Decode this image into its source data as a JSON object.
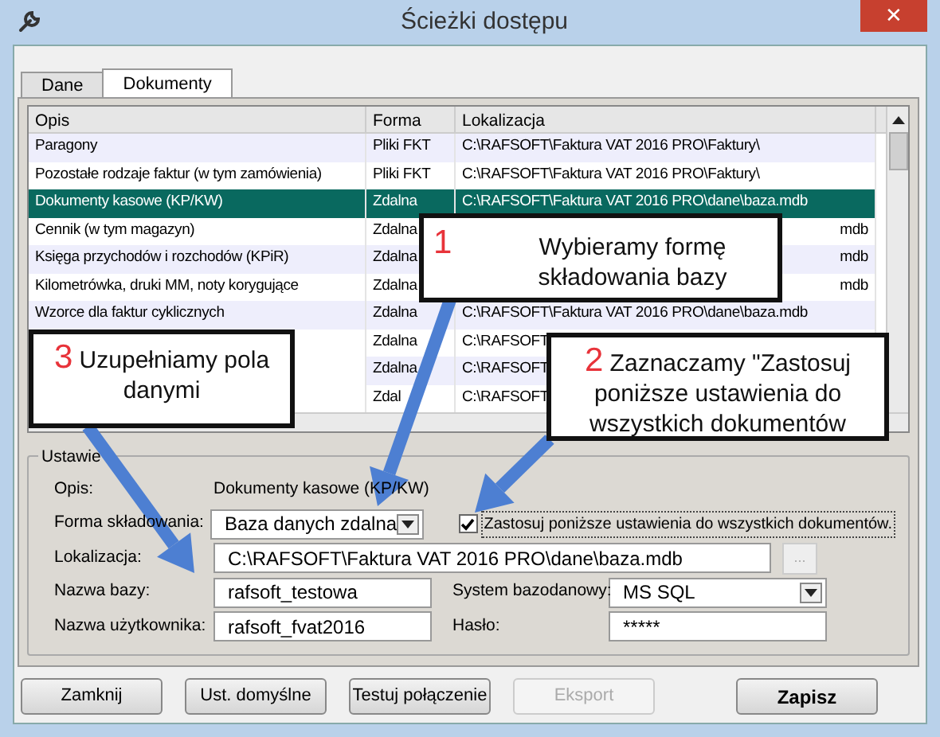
{
  "window": {
    "title": "Ścieżki dostępu",
    "close": "✕"
  },
  "tabs": [
    {
      "label": "Dane",
      "selected": false
    },
    {
      "label": "Dokumenty",
      "selected": true
    }
  ],
  "table": {
    "columns": [
      "Opis",
      "Forma",
      "Lokalizacja"
    ],
    "rows": [
      {
        "opis": "Paragony",
        "forma": "Pliki FKT",
        "lokalizacja": "C:\\RAFSOFT\\Faktura VAT 2016 PRO\\Faktury\\",
        "selected": false,
        "partial": false
      },
      {
        "opis": "Pozostałe rodzaje faktur (w tym zamówienia)",
        "forma": "Pliki FKT",
        "lokalizacja": "C:\\RAFSOFT\\Faktura VAT 2016 PRO\\Faktury\\",
        "selected": false,
        "partial": false
      },
      {
        "opis": "Dokumenty kasowe (KP/KW)",
        "forma": "Zdalna",
        "lokalizacja": "C:\\RAFSOFT\\Faktura VAT 2016 PRO\\dane\\baza.mdb",
        "selected": true,
        "partial": false
      },
      {
        "opis": "Cennik (w tym magazyn)",
        "forma": "Zdalna",
        "lokalizacja": "mdb",
        "selected": false,
        "partial": true
      },
      {
        "opis": "Księga przychodów i rozchodów (KPiR)",
        "forma": "Zdalna",
        "lokalizacja": "mdb",
        "selected": false,
        "partial": true
      },
      {
        "opis": "Kilometrówka, druki MM, noty korygujące",
        "forma": "Zdalna",
        "lokalizacja": "mdb",
        "selected": false,
        "partial": true
      },
      {
        "opis": "Wzorce dla faktur cyklicznych",
        "forma": "Zdalna",
        "lokalizacja": "C:\\RAFSOFT\\Faktura VAT 2016 PRO\\dane\\baza.mdb",
        "selected": false,
        "partial": false
      },
      {
        "forma": "Zdalna",
        "lokalizacja": "C:\\RAFSOFT",
        "selected": false,
        "partial": false
      },
      {
        "forma": "Zdalna",
        "lokalizacja": "C:\\RAFSOFT",
        "selected": false,
        "partial": false
      },
      {
        "forma": "Zdal",
        "lokalizacja": "C:\\RAFSOFT",
        "selected": false,
        "partial": false
      }
    ]
  },
  "settings": {
    "title": "Ustawie",
    "opis": {
      "label": "Opis:",
      "value": "Dokumenty kasowe (KP/KW)"
    },
    "forma": {
      "label": "Forma składowania:",
      "value": "Baza danych zdalna"
    },
    "apply_all": {
      "label": "Zastosuj poniższe ustawienia do wszystkich dokumentów.",
      "checked": true
    },
    "lokalizacja": {
      "label": "Lokalizacja:",
      "value": "C:\\RAFSOFT\\Faktura VAT 2016 PRO\\dane\\baza.mdb",
      "browse": "..."
    },
    "nazwa_bazy": {
      "label": "Nazwa bazy:",
      "value": "rafsoft_testowa"
    },
    "system": {
      "label": "System bazodanowy:",
      "value": "MS SQL"
    },
    "uzytkownik": {
      "label": "Nazwa użytkownika:",
      "value": "rafsoft_fvat2016"
    },
    "haslo": {
      "label": "Hasło:",
      "value": "*****"
    }
  },
  "buttons": [
    {
      "label": "Zamknij",
      "disabled": false,
      "default": false
    },
    {
      "label": "Ust. domyślne",
      "disabled": false,
      "default": false
    },
    {
      "label": "Testuj połączenie",
      "disabled": false,
      "default": false
    },
    {
      "label": "Eksport",
      "disabled": true,
      "default": false
    },
    {
      "label": "Zapisz",
      "disabled": false,
      "default": true
    }
  ],
  "callouts": [
    {
      "number": "1",
      "text": "Wybieramy formę składowania bazy"
    },
    {
      "number": "3",
      "text": "Uzupełniamy pola danymi"
    },
    {
      "number": "2",
      "text": "Zaznaczamy \"Zastosuj poniższe ustawienia do wszystkich dokumentów"
    }
  ]
}
